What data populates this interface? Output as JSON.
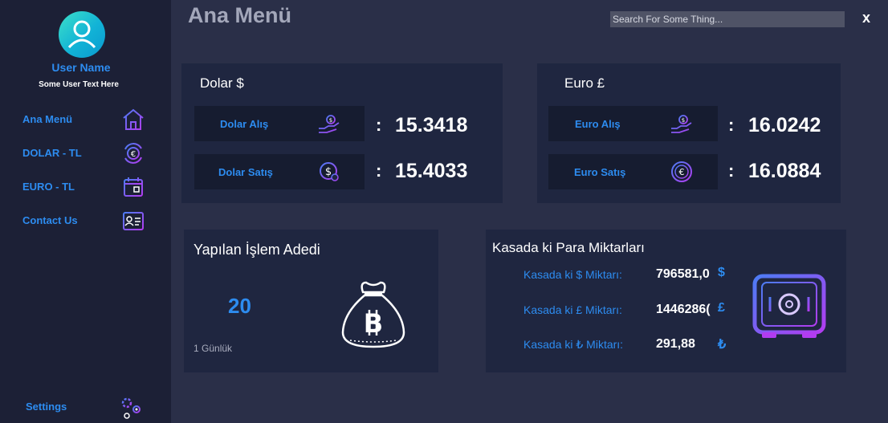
{
  "app": {
    "title": "Ana Menü",
    "close_label": "x"
  },
  "search": {
    "placeholder": "Search For Some Thing..."
  },
  "user": {
    "name": "User Name",
    "subtitle": "Some User Text Here"
  },
  "sidebar": {
    "items": [
      {
        "label": "Ana Menü",
        "icon": "home-icon"
      },
      {
        "label": "DOLAR - TL",
        "icon": "exchange-icon"
      },
      {
        "label": "EURO - TL",
        "icon": "calendar-icon"
      },
      {
        "label": "Contact Us",
        "icon": "contact-card-icon"
      }
    ],
    "settings": {
      "label": "Settings",
      "icon": "gears-icon"
    }
  },
  "dollar": {
    "title": "Dolar $",
    "buy": {
      "label": "Dolar Alış",
      "value": "15.3418",
      "icon": "hand-coin-icon"
    },
    "sell": {
      "label": "Dolar Satış",
      "value": "15.4033",
      "icon": "dollar-coin-icon"
    }
  },
  "euro": {
    "title": "Euro £",
    "buy": {
      "label": "Euro Alış",
      "value": "16.0242",
      "icon": "hand-coin-icon"
    },
    "sell": {
      "label": "Euro Satış",
      "value": "16.0884",
      "icon": "euro-coin-icon"
    }
  },
  "colon": ":",
  "transactions": {
    "title": "Yapılan İşlem Adedi",
    "count": "20",
    "note": "1 Günlük",
    "icon": "bitcoin-bag-icon"
  },
  "vault": {
    "title": "Kasada ki Para Miktarları",
    "icon": "safe-icon",
    "rows": [
      {
        "label": "Kasada ki $ Miktarı:",
        "value": "796581,0",
        "symbol": "$"
      },
      {
        "label": "Kasada ki £ Miktarı:",
        "value": "1446286(",
        "symbol": "£"
      },
      {
        "label": "Kasada ki ₺ Miktarı:",
        "value": "291,88",
        "symbol": "₺"
      }
    ]
  },
  "colors": {
    "accent": "#2d8cf0",
    "sidebar_bg": "#1c2036",
    "main_bg": "#2a2f48",
    "panel_bg": "#1f2640",
    "box_bg": "#161c30",
    "icon_purple": "#9b3cf0"
  }
}
